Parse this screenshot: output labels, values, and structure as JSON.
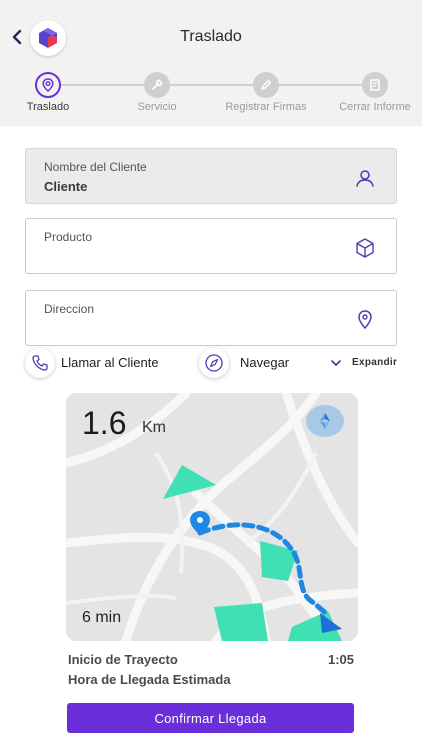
{
  "header": {
    "title": "Traslado",
    "back_icon": "chevron-left-icon",
    "logo_icon": "brand-logo-icon"
  },
  "stepper": {
    "steps": [
      {
        "label": "Traslado",
        "icon": "location-pin-icon",
        "active": true
      },
      {
        "label": "Servicio",
        "icon": "wrench-icon",
        "active": false
      },
      {
        "label": "Registrar Firmas",
        "icon": "pencil-icon",
        "active": false
      },
      {
        "label": "Cerrar Informe",
        "icon": "report-icon",
        "active": false
      }
    ]
  },
  "form": {
    "client": {
      "label": "Nombre del Cliente",
      "value": "Cliente",
      "icon": "user-icon"
    },
    "product": {
      "label": "Producto",
      "value": "",
      "icon": "box-icon"
    },
    "address": {
      "label": "Direccion",
      "value": "",
      "icon": "location-pin-icon"
    }
  },
  "actions": {
    "call_label": "Llamar al Cliente",
    "navigate_label": "Navegar",
    "expand_label": "Expandir"
  },
  "map": {
    "distance_value": "1.6",
    "distance_unit": "Km",
    "eta": "6 min"
  },
  "trip": {
    "start_label": "Inicio de Trayecto",
    "start_time": "1:05",
    "arrival_label": "Hora de Llegada Estimada"
  },
  "confirm_label": "Confirmar Llegada",
  "colors": {
    "accent": "#6a2fd8",
    "map_green": "#3ee0b4",
    "route_blue": "#1e88e5"
  }
}
